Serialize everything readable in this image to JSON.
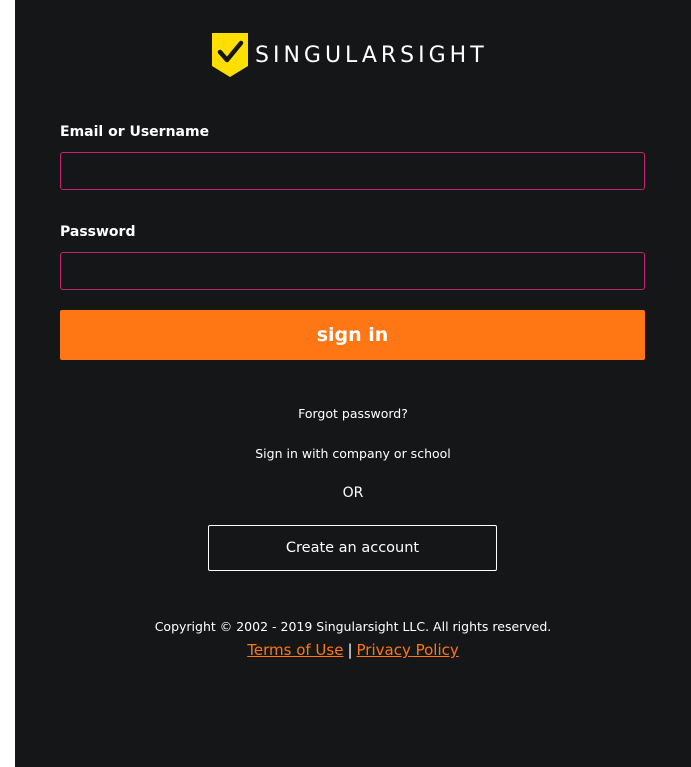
{
  "brand": {
    "name": "SINGULARSIGHT",
    "logo_icon": "shield-check-icon",
    "logo_color": "#ffde00"
  },
  "form": {
    "email_label": "Email or Username",
    "email_value": "",
    "password_label": "Password",
    "password_value": "",
    "submit_label": "sign in"
  },
  "links": {
    "forgot_password": "Forgot password?",
    "sso": "Sign in with company or school",
    "or": "OR",
    "create_account": "Create an account"
  },
  "footer": {
    "copyright": "Copyright © 2002 - 2019 Singularsight LLC. All rights reserved.",
    "terms": "Terms of Use",
    "separator": "|",
    "privacy": "Privacy Policy"
  },
  "colors": {
    "background": "#151618",
    "accent": "#ff7614",
    "input_border": "#c2256f",
    "text": "#ffffff"
  }
}
